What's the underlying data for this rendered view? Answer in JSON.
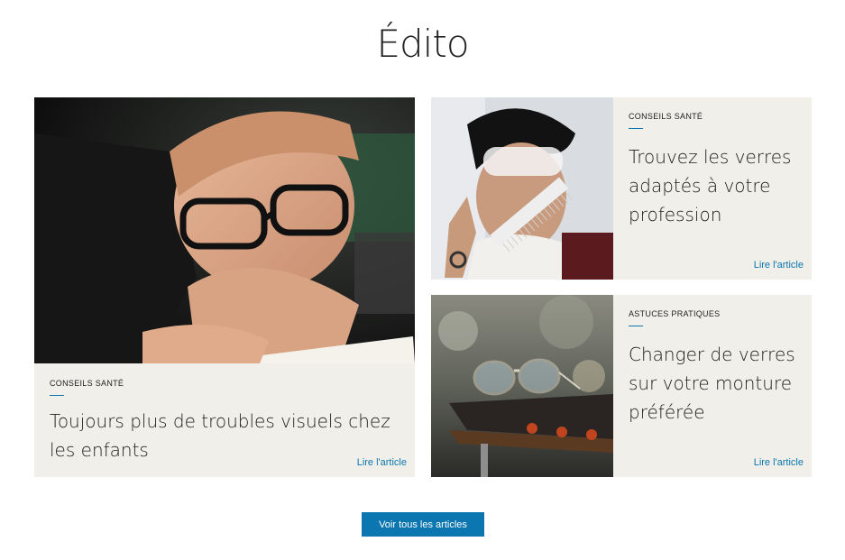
{
  "page": {
    "title": "Édito"
  },
  "articles": [
    {
      "category": "CONSEILS SANTÉ",
      "title": "Toujours plus de troubles visuels chez les enfants",
      "link": "Lire l'article",
      "image": "child-reading-with-glasses"
    },
    {
      "category": "CONSEILS SANTÉ",
      "title": "Trouvez les verres adaptés à votre profession",
      "link": "Lire l'article",
      "image": "hairdresser-with-comb-and-face-shield"
    },
    {
      "category": "ASTUCES PRATIQUES",
      "title": "Changer de verres sur votre monture préférée",
      "link": "Lire l'article",
      "image": "glasses-on-metal-surface"
    }
  ],
  "cta": {
    "label": "Voir tous les articles"
  },
  "colors": {
    "accent": "#0b76b0",
    "card_bg": "#f1efea"
  }
}
